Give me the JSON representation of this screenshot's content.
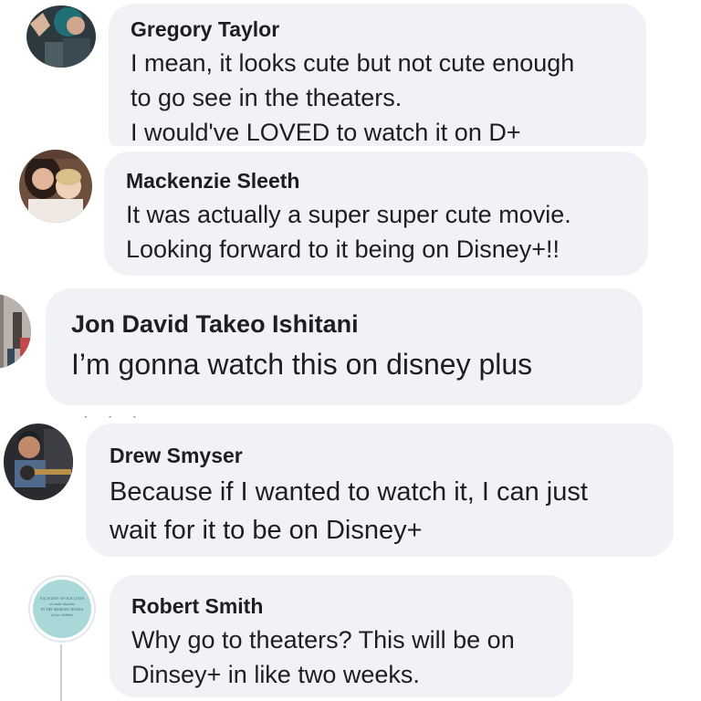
{
  "comments": [
    {
      "author": "Gregory Taylor",
      "lines": [
        "I mean, it looks cute but not cute enough",
        "to go see in the theaters.",
        "I would've LOVED to watch it on D+"
      ]
    },
    {
      "author": "Mackenzie Sleeth",
      "lines": [
        "It was actually a super super cute movie.",
        "Looking forward to it being on Disney+!!"
      ]
    },
    {
      "author": "Jon David Takeo Ishitani",
      "lines": [
        "I’m gonna watch this on disney plus"
      ]
    },
    {
      "author": "Drew Smyser",
      "lines": [
        "Because if I wanted to watch it, I can just",
        "wait for it to be on Disney+"
      ]
    },
    {
      "author": "Robert Smith",
      "lines": [
        "Why go to theaters? This will be on",
        "Dinsey+ in like two weeks."
      ]
    }
  ],
  "avatars": {
    "robert_badge_lines": [
      "EACH DAY OF OUR LIVES",
      "we make deposits",
      "IN THE MEMORY BANKS",
      "of our children"
    ]
  },
  "colors": {
    "bubble": "#f0f2f5",
    "text": "#1c1e21",
    "badge": "#a8d8d8"
  }
}
